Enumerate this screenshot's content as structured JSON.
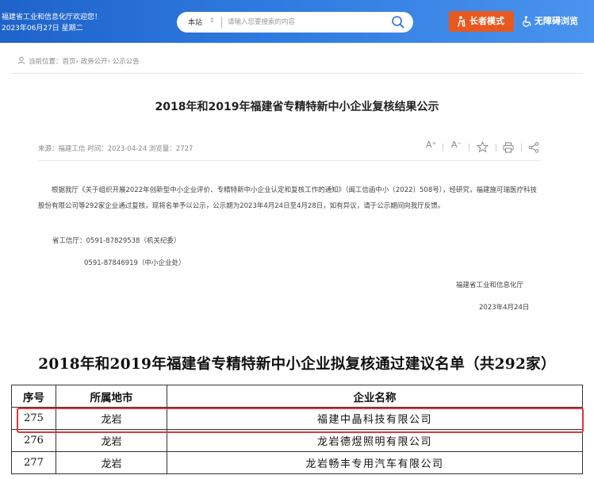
{
  "header": {
    "welcome": "福建省工业和信息化厅欢迎您！",
    "date": "2023年06月27日 星期二",
    "search": {
      "site_label": "本站",
      "placeholder": "请输入您要搜索的内容"
    },
    "elder_mode_label": "长者模式",
    "accessible_label": "无障碍浏览",
    "accent_color": "#2f7ae0",
    "elder_color": "#e8591f"
  },
  "breadcrumb": {
    "text": "当前位置：首页› 政务公开› 公示公告"
  },
  "article": {
    "title": "2018年和2019年福建省专精特新中小企业复核结果公示",
    "meta": "来源：福建工信  时间：2023-04-24  浏览量：2727",
    "tools": {
      "font_increase": "A⁺",
      "font_decrease": "A⁻",
      "favorite": "☆",
      "print": "⎙",
      "share": "share"
    },
    "body": "根据我厅《关于组织开展2022年创新型中小企业评价、专精特新中小企业认定和复核工作的通知》（闽工信函中小〔2022〕508号），经研究，福建施可瑞医疗科技股份有限公司等292家企业通过复核，现将名单予以公示，公示期为2023年4月24日至4月28日，如有异议，请于公示期间向我厅反馈。",
    "contact1": "省工信厅：0591-87829538（机关纪委）",
    "contact2": "0591-87846919（中小企业处）",
    "sign_org": "福建省工业和信息化厅",
    "sign_date": "2023年4月24日"
  },
  "list": {
    "title": "2018年和2019年福建省专精特新中小企业拟复核通过建议名单（共292家）",
    "columns": [
      "序号",
      "所属地市",
      "企业名称"
    ],
    "rows": [
      [
        "275",
        "龙岩",
        "福建中晶科技有限公司"
      ],
      [
        "276",
        "龙岩",
        "龙岩德煜照明有限公司"
      ],
      [
        "277",
        "龙岩",
        "龙岩畅丰专用汽车有限公司"
      ]
    ],
    "highlight_color": "#e0353a"
  }
}
